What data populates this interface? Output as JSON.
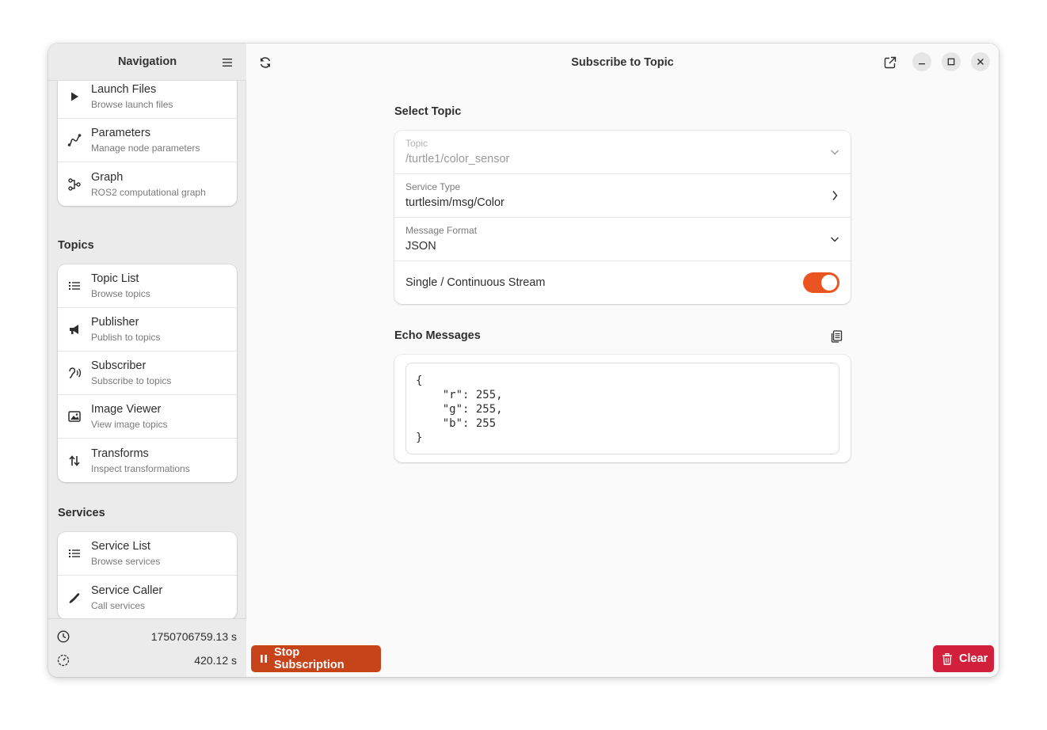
{
  "sidebar": {
    "title": "Navigation",
    "top_items": [
      {
        "label": "Launch Files",
        "sub": "Browse launch files"
      },
      {
        "label": "Parameters",
        "sub": "Manage node parameters"
      },
      {
        "label": "Graph",
        "sub": "ROS2 computational graph"
      }
    ],
    "topics_title": "Topics",
    "topics_items": [
      {
        "label": "Topic List",
        "sub": "Browse topics"
      },
      {
        "label": "Publisher",
        "sub": "Publish to topics"
      },
      {
        "label": "Subscriber",
        "sub": "Subscribe to topics"
      },
      {
        "label": "Image Viewer",
        "sub": "View image topics"
      },
      {
        "label": "Transforms",
        "sub": "Inspect transformations"
      }
    ],
    "services_title": "Services",
    "services_items": [
      {
        "label": "Service List",
        "sub": "Browse services"
      },
      {
        "label": "Service Caller",
        "sub": "Call services"
      }
    ],
    "footer": {
      "clock_value": "1750706759.13 s",
      "elapsed_value": "420.12 s"
    }
  },
  "main": {
    "title": "Subscribe to Topic",
    "select_topic_title": "Select Topic",
    "topic": {
      "label": "Topic",
      "value": "/turtle1/color_sensor"
    },
    "service_type": {
      "label": "Service Type",
      "value": "turtlesim/msg/Color"
    },
    "message_format": {
      "label": "Message Format",
      "value": "JSON"
    },
    "stream_toggle": {
      "label": "Single / Continuous Stream",
      "on": true
    },
    "echo_title": "Echo Messages",
    "echo_content": "{\n    \"r\": 255,\n    \"g\": 255,\n    \"b\": 255\n}",
    "stop_button": "Stop Subscription",
    "clear_button": "Clear"
  },
  "colors": {
    "accent": "#e95420",
    "stop_button": "#c7431a",
    "clear_button": "#d21f3c"
  }
}
